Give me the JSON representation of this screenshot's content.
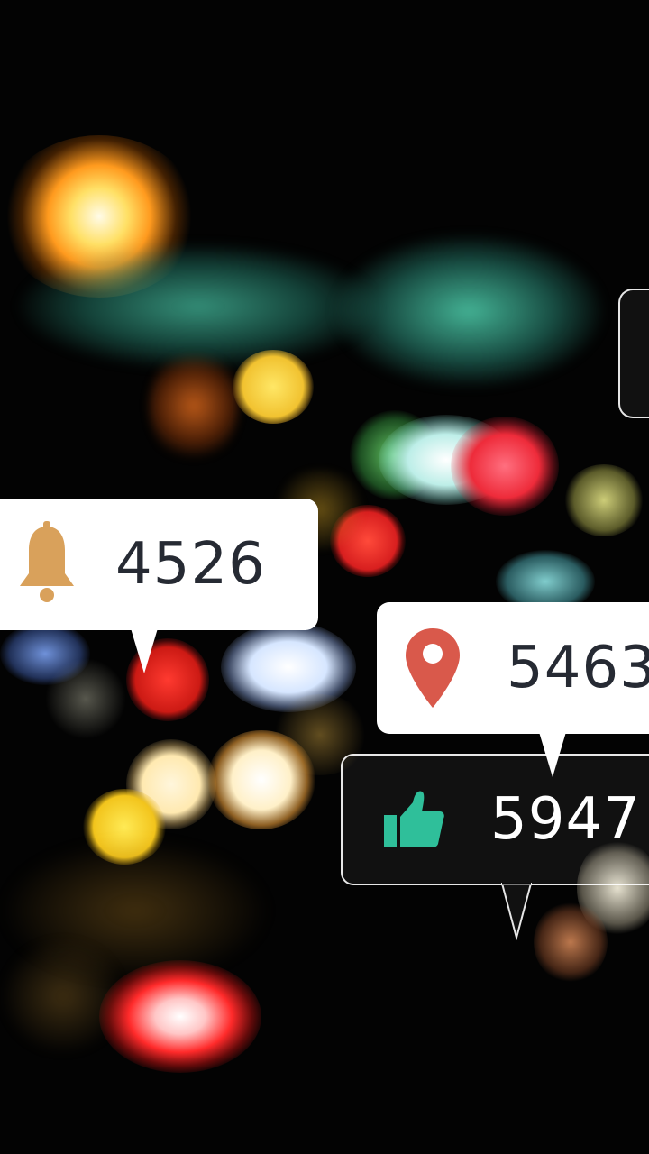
{
  "notifications": {
    "alerts": {
      "count": "4526",
      "icon": "bell-icon",
      "icon_color": "#d9a15b"
    },
    "places": {
      "count": "5463",
      "icon": "location-pin-icon",
      "icon_color": "#d9594b"
    },
    "likes": {
      "count": "5947",
      "icon": "thumbs-up-icon",
      "icon_color": "#2fbf9a"
    }
  },
  "colors": {
    "background": "#030303",
    "bubble_fill": "#ffffff",
    "bubble_text": "#262a33"
  }
}
